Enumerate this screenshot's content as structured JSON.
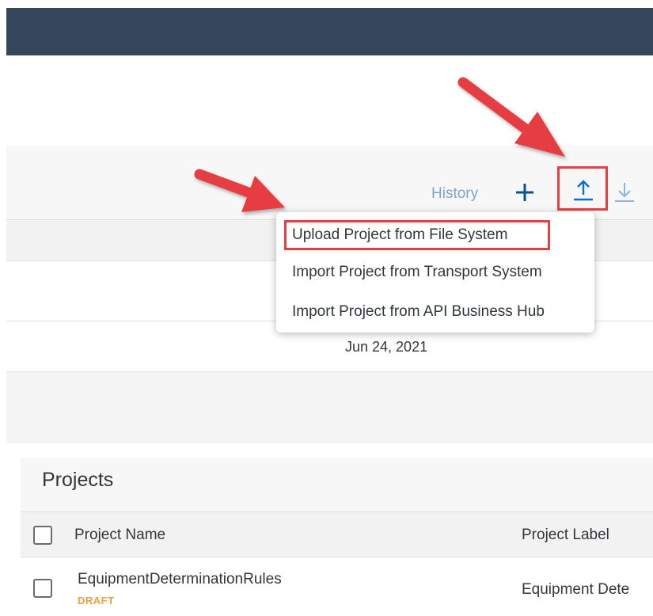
{
  "toolbar": {
    "history_label": "History",
    "add_icon": "plus-icon",
    "upload_icon": "upload-icon",
    "download_icon": "download-icon"
  },
  "upload_menu": {
    "items": [
      {
        "label": "Upload Project from File System",
        "highlighted": true
      },
      {
        "label": "Import Project from Transport System"
      },
      {
        "label": "Import Project from API Business Hub"
      }
    ]
  },
  "background_row": {
    "date": "Jun 24, 2021"
  },
  "projects": {
    "title": "Projects",
    "columns": [
      "Project Name",
      "Project Label"
    ],
    "rows": [
      {
        "name": "EquipmentDeterminationRules",
        "status": "DRAFT",
        "label": "Equipment Dete"
      }
    ]
  },
  "colors": {
    "shell": "#34475b",
    "accent_blue": "#0a6ed1",
    "highlight_red": "#e53e43",
    "draft_orange": "#e9a23b"
  }
}
